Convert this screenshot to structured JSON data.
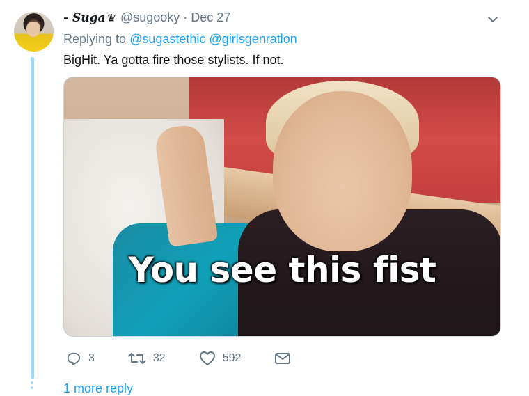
{
  "tweet": {
    "display_name": "- Suga",
    "crown_glyph": "♛",
    "handle": "@sugooky",
    "separator": "·",
    "date": "Dec 27",
    "replying_prefix": "Replying to",
    "replying_to": [
      "@sugastethic",
      "@girlsgenratlon"
    ],
    "text": "BigHit. Ya gotta fire those stylists. If not.",
    "media_caption": "You see this fist"
  },
  "actions": {
    "replies": "3",
    "retweets": "32",
    "likes": "592"
  },
  "thread": {
    "more_reply": "1 more reply"
  },
  "icons": {
    "menu": "chevron-down-icon",
    "reply": "reply-icon",
    "retweet": "retweet-icon",
    "like": "heart-icon",
    "dm": "envelope-icon"
  },
  "colors": {
    "link": "#1da1f2",
    "muted": "#657786",
    "thread_line": "#a5d6f5"
  }
}
